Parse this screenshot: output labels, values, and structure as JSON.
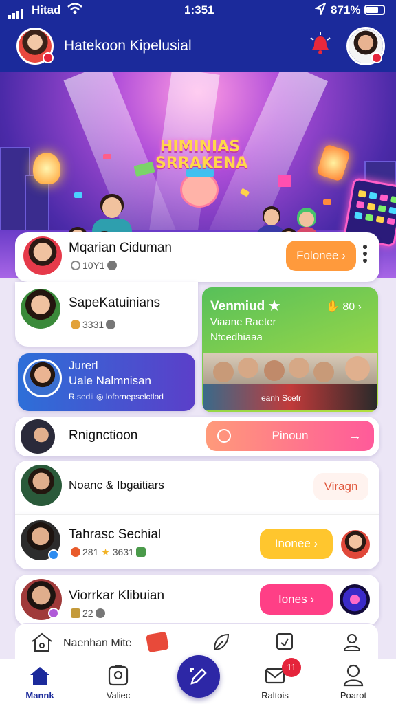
{
  "status_bar": {
    "carrier": "Hitad",
    "time": "1:351",
    "battery": "871%"
  },
  "header": {
    "title": "Hatekoon Kipelusial",
    "bell_icon": "alarm-bell-icon"
  },
  "banner": {
    "logo_line1": "HIMINIAS",
    "logo_line2": "SRRAKENA"
  },
  "cards": {
    "top": {
      "name": "Mqarian Ciduman",
      "meta": "10Y1",
      "button": "Folonee ›"
    },
    "second": {
      "name": "SapeKatuinians",
      "meta": "3331"
    },
    "blue": {
      "line1": "Jurerl",
      "line2": "Uale Nalmnisan",
      "meta": "R.sedii ◎ lofornepselctlod"
    },
    "green": {
      "title": "Venmiud ★",
      "count": "80 ›",
      "subtitle": "Viaane Raeter",
      "subtitle2": "Ntcedhiaaa",
      "photo_caption": "eanh Scetr"
    },
    "row1": {
      "name": "Rnignctioon",
      "button": "Pinoun"
    },
    "row2": {
      "name": "Noanc & Ibgaitiars",
      "button": "Viragn"
    },
    "row3": {
      "name": "Tahrasc Sechial",
      "meta_a": "281",
      "meta_b": "3631",
      "button": "Inonee ›"
    },
    "row4": {
      "name": "Viorrkar Klibuian",
      "meta": "22",
      "button": "Iones ›"
    }
  },
  "sub_nav": {
    "label": "Naenhan Mite"
  },
  "tabbar": {
    "tabs": [
      "Mannk",
      "Valiec",
      "Raltois",
      "Poarot"
    ],
    "badge": "11"
  },
  "colors": {
    "brand": "#1b2a9b",
    "orange": "#ff9a3c",
    "green": "#6cc447",
    "pink": "#ff3f86",
    "yellow": "#ffc62e"
  }
}
